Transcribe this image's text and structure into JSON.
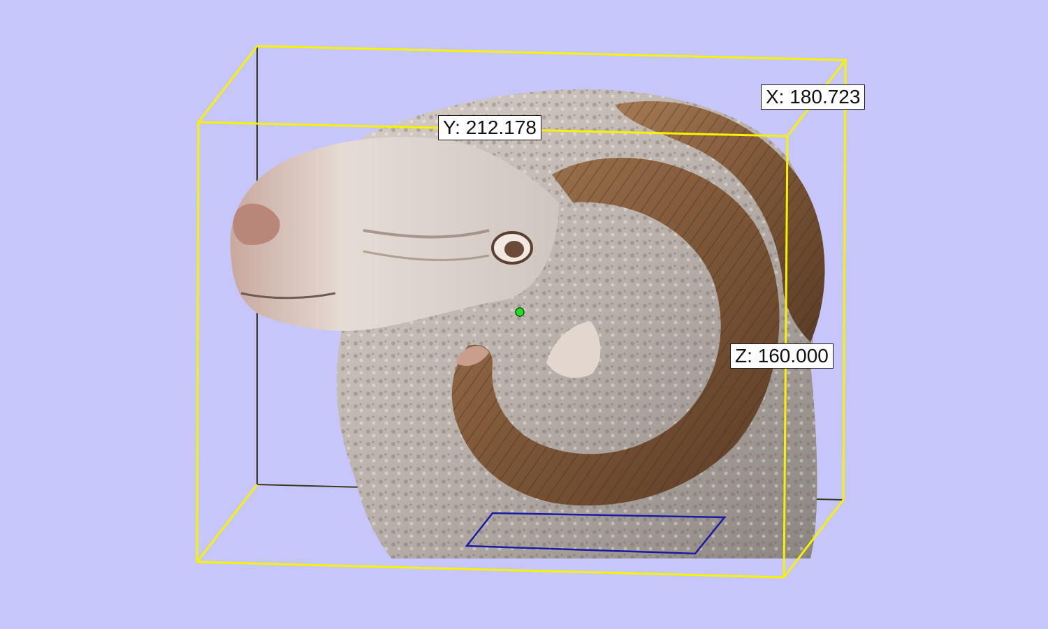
{
  "viewer": {
    "background_color": "#c6c6fb",
    "bounding_box_color": "#f7f200",
    "selection_rect_color": "#1a1aa8",
    "pivot_color": "#22dd22"
  },
  "model": {
    "icon": "ram-head-3d-model"
  },
  "dimensions": {
    "x_label": "X: 180.723",
    "y_label": "Y: 212.178",
    "z_label": "Z: 160.000"
  }
}
